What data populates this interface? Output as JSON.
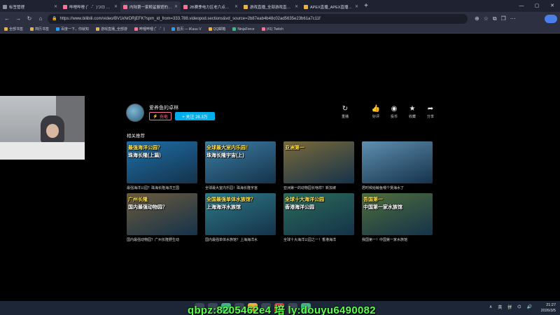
{
  "browser": {
    "tabs": [
      {
        "label": "标签管理",
        "active": false,
        "favicon": "gray"
      },
      {
        "label": "哔哩哔哩 (゜-゜)つロ 干杯~-bili",
        "active": false,
        "favicon": "pink"
      },
      {
        "label": "内陆第一家鲸鲨展馆的海洋公园",
        "active": true,
        "favicon": "pink"
      },
      {
        "label": "2B赛季电力区老六点位整合_特",
        "active": false,
        "favicon": "pink"
      },
      {
        "label": "游戏直播_全部游戏直播_斗鱼直",
        "active": false,
        "favicon": "gold"
      },
      {
        "label": "APEX直播_APEX直播解说视频",
        "active": false,
        "favicon": "gold"
      }
    ],
    "new_tab_symbol": "+",
    "url": "https://www.bilibili.com/video/BV1kNrDRjEFK?spm_id_from=333.788.videopod.sections&vd_source=2b87eab4b48c02ad5635e23b61a7c11f",
    "bookmarks": [
      {
        "label": "全部书签",
        "color": "gold"
      },
      {
        "label": "简历书签",
        "color": "gold"
      },
      {
        "label": "百度一下，你就知",
        "color": "blue"
      },
      {
        "label": "游戏直播_全部游",
        "color": "gold"
      },
      {
        "label": "哔哩哔哩 (゜-゜)",
        "color": "pink"
      },
      {
        "label": "首页 — iKuuu V",
        "color": "blue"
      },
      {
        "label": "QQ邮箱",
        "color": "gold"
      },
      {
        "label": "NinjaForce",
        "color": "green"
      },
      {
        "label": "(41) Twitch",
        "color": "pink"
      }
    ]
  },
  "uploader": {
    "name": "爱养鱼的卓林",
    "charge_label": "充电",
    "follow_label": "+ 关注 28.3万"
  },
  "actions": [
    {
      "icon": "refresh-icon",
      "glyph": "↻",
      "label": "重播"
    },
    {
      "icon": "like-icon",
      "glyph": "👍",
      "label": "好评"
    },
    {
      "icon": "coin-icon",
      "glyph": "◉",
      "label": "投币"
    },
    {
      "icon": "star-icon",
      "glyph": "★",
      "label": "收藏"
    },
    {
      "icon": "share-icon",
      "glyph": "➦",
      "label": "分享"
    }
  ],
  "recommend": {
    "title": "相关推荐",
    "cards": [
      {
        "cap1": "最强海洋公园？",
        "cap2": "珠海长隆(上篇)",
        "title": "最强海洋公园？珠海长隆海洋王国",
        "bg": "#1d6fa8"
      },
      {
        "cap1": "全球最大室内乐园！",
        "cap2": "珠海长隆宇宙(上)",
        "title": "全球最大室内乐园！珠海长隆宇宙",
        "bg": "#3c7ea3"
      },
      {
        "cap1": "亚洲第一",
        "cap2": "",
        "title": "亚洲第一的动物园长啥样？新加坡",
        "bg": "#7a6a3a"
      },
      {
        "cap1": "",
        "cap2": "",
        "title": "居时候给鲸鱼喂个煲海水了",
        "bg": "#5f8fb0"
      },
      {
        "cap1": "广州长隆",
        "cap2": "国内最强动物园？",
        "title": "国内最强动物园？广州长隆野生动",
        "bg": "#6b5a3d"
      },
      {
        "cap1": "全国最强单体水族馆？",
        "cap2": "上海海洋水族馆",
        "title": "国内最强单体水族馆？上海海洋水",
        "bg": "#2d7a86"
      },
      {
        "cap1": "全球十大海洋公园",
        "cap2": "香港海洋公园",
        "title": "全球十大海洋公园之一！香港海洋",
        "bg": "#2b6c59"
      },
      {
        "cap1": "吾国第一",
        "cap2": "中国第一家水族馆",
        "title": "我国第一！中国第一家水族馆",
        "bg": "#4f6e3b"
      }
    ]
  },
  "taskbar": {
    "tray_input": "英",
    "tray_pinyin": "拼",
    "time": "21:27",
    "date": "2026/3/5"
  },
  "overlay": {
    "text": "qbpz:8205462e4     培  ly:douyu6490082"
  }
}
